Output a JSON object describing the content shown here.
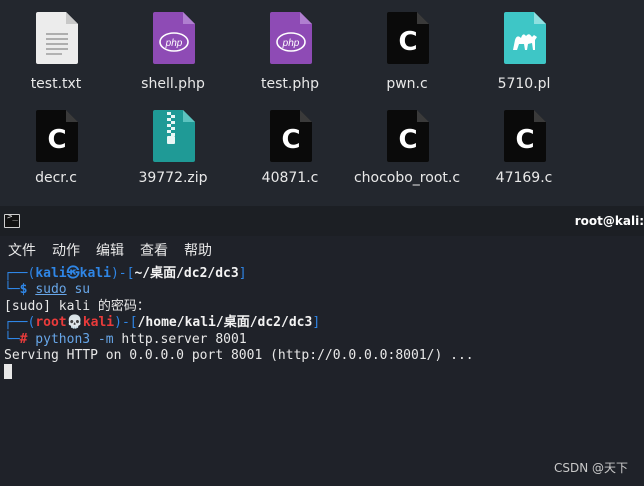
{
  "desktop": {
    "files": [
      {
        "name": "test.txt",
        "icon": "text-file-icon"
      },
      {
        "name": "shell.php",
        "icon": "php-file-icon",
        "badge": "php"
      },
      {
        "name": "test.php",
        "icon": "php-file-icon",
        "badge": "php"
      },
      {
        "name": "pwn.c",
        "icon": "c-file-icon",
        "badge": "C"
      },
      {
        "name": "5710.pl",
        "icon": "perl-file-icon"
      },
      {
        "name": "decr.c",
        "icon": "c-file-icon",
        "badge": "C"
      },
      {
        "name": "39772.zip",
        "icon": "zip-file-icon"
      },
      {
        "name": "40871.c",
        "icon": "c-file-icon",
        "badge": "C"
      },
      {
        "name": "chocobo_root.c",
        "icon": "c-file-icon",
        "badge": "C"
      },
      {
        "name": "47169.c",
        "icon": "c-file-icon",
        "badge": "C"
      }
    ]
  },
  "terminal": {
    "title": "root@kali:",
    "term_icon_glyph": ">_",
    "menu": [
      "文件",
      "动作",
      "编辑",
      "查看",
      "帮助"
    ],
    "prompt1": {
      "corner": "┌──(",
      "user": "kali",
      "at": "㉿",
      "host": "kali",
      "close": ")-[",
      "path": "~/桌面/dc2/dc3",
      "end": "]"
    },
    "cmd1": {
      "corner": "└─",
      "sym": "$",
      "cmd": "sudo",
      "arg": " su"
    },
    "output1": "[sudo] kali 的密码：",
    "prompt2": {
      "corner": "┌──(",
      "user": "root",
      "at": "💀",
      "host": "kali",
      "close": ")-[",
      "path": "/home/kali/桌面/dc2/dc3",
      "end": "]"
    },
    "cmd2": {
      "corner": "└─",
      "sym": "#",
      "cmd": " python3",
      "flag": " -m",
      "arg": " http.server 8001"
    },
    "output2": "Serving HTTP on 0.0.0.0 port 8001 (http://0.0.0.0:8001/) ..."
  },
  "watermark": "CSDN @天下",
  "colors": {
    "c_icon": "#0a0a0a",
    "php_icon": "#8e4bb5",
    "zip_icon": "#1f9a96",
    "perl_icon": "#3ec6c6",
    "prompt_blue": "#2f86e6",
    "prompt_red": "#e83b3b"
  }
}
